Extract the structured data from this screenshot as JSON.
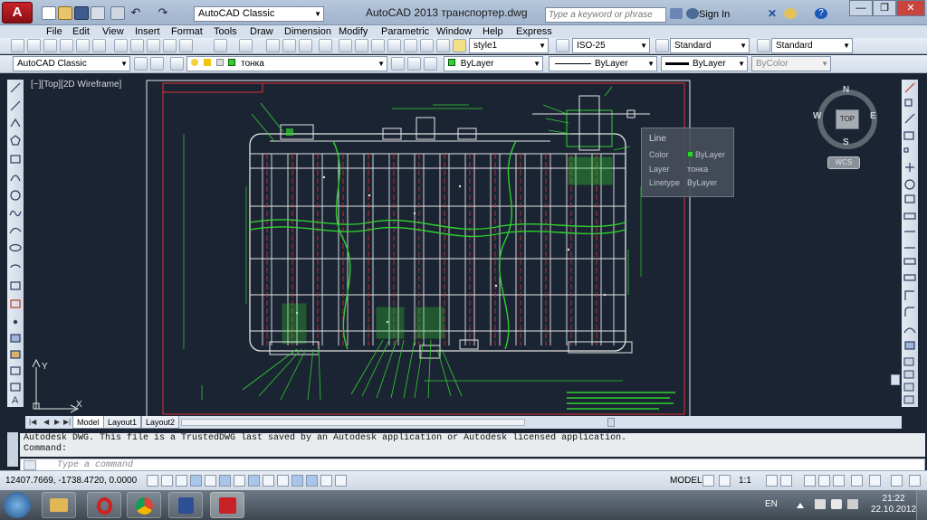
{
  "titlebar": {
    "app_logo": "A",
    "workspace": "AutoCAD Classic",
    "title": "AutoCAD 2013      транспортер.dwg",
    "search_placeholder": "Type a keyword or phrase",
    "sign_in": "Sign In",
    "help": "?",
    "minimize": "—",
    "restore": "❐",
    "close": "✕"
  },
  "menu": [
    "File",
    "Edit",
    "View",
    "Insert",
    "Format",
    "Tools",
    "Draw",
    "Dimension",
    "Modify",
    "Parametric",
    "Window",
    "Help",
    "Express"
  ],
  "styles_toolbar": {
    "text_style": "style1",
    "dim_style": "ISO-25",
    "table_style": "Standard",
    "mleader_style": "Standard"
  },
  "layers_toolbar": {
    "workspace": "AutoCAD Classic",
    "layer": "тонка",
    "color": "ByLayer",
    "linetype": "ByLayer",
    "lineweight": "ByLayer",
    "plotstyle": "ByColor"
  },
  "viewport": {
    "label": "[−][Top][2D Wireframe]",
    "cube_top": "TOP",
    "north": "N",
    "south": "S",
    "east": "E",
    "west": "W",
    "wcs": "WCS"
  },
  "tooltip": {
    "title": "Line",
    "rows": [
      {
        "label": "Color",
        "value": "ByLayer"
      },
      {
        "label": "Layer",
        "value": "тонка"
      },
      {
        "label": "Linetype",
        "value": "ByLayer"
      }
    ]
  },
  "tabs": [
    "Model",
    "Layout1",
    "Layout2"
  ],
  "command": {
    "history_line1": "Autodesk DWG.  This file is a TrustedDWG last saved by an Autodesk application or Autodesk licensed application.",
    "history_line2": "Command:",
    "placeholder": "Type a command"
  },
  "statusbar": {
    "coords": "12407.7669, -1738.4720, 0.0000",
    "model": "MODEL",
    "scale": "1:1"
  },
  "taskbar": {
    "lang": "EN",
    "time": "21:22",
    "date": "22.10.2012"
  },
  "colors": {
    "drawing_bg": "#1b2433",
    "drawing_line": "#e6e6e6",
    "accent_green": "#2fd12f",
    "accent_red": "#e03030"
  }
}
